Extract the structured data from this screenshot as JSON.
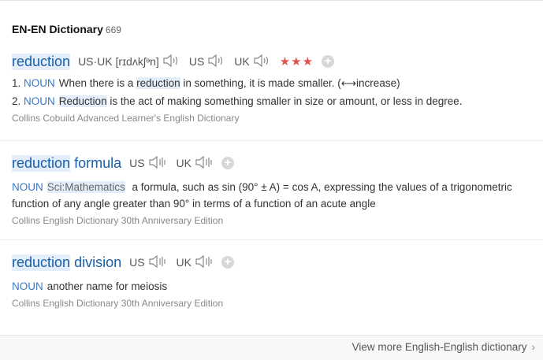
{
  "header": {
    "title": "EN-EN Dictionary",
    "count": "669"
  },
  "entries": [
    {
      "word_parts": [
        "reduction"
      ],
      "phonetics": [
        {
          "label": "US·UK [rɪdʌkʃᵊn]"
        },
        {
          "label": "US"
        },
        {
          "label": "UK"
        }
      ],
      "stars": "★★★",
      "senses": [
        {
          "num": "1.",
          "pos": "NOUN",
          "pre": "When there is a ",
          "hl": "reduction",
          "post": " in something, it is made smaller. (⟷increase)"
        },
        {
          "num": "2.",
          "pos": "NOUN",
          "pre": "",
          "hl": "Reduction",
          "post": " is the act of making something smaller in size or amount, or less in degree."
        }
      ],
      "source": "Collins Cobuild Advanced Learner's English Dictionary"
    },
    {
      "word_parts": [
        "reduction",
        "formula"
      ],
      "phonetics": [
        {
          "label": "US"
        },
        {
          "label": "UK"
        }
      ],
      "pos": "NOUN",
      "domain": "Sci:Mathematics",
      "definition": "a formula, such as sin (90° ± A) = cos A, expressing the values of a trigonometric function of any angle greater than 90° in terms of a function of an acute angle",
      "source": "Collins English Dictionary 30th Anniversary Edition"
    },
    {
      "word_parts": [
        "reduction",
        "division"
      ],
      "phonetics": [
        {
          "label": "US"
        },
        {
          "label": "UK"
        }
      ],
      "pos": "NOUN",
      "definition": "another name for meiosis",
      "source": "Collins English Dictionary 30th Anniversary Edition"
    }
  ],
  "footer": {
    "view_more": "View more English-English dictionary"
  },
  "icons": {
    "speaker": "speaker-icon",
    "plus": "add-icon",
    "chevron": "chevron-right-icon"
  },
  "colors": {
    "headword": "#1a5fa8",
    "pos": "#3a78c3",
    "stars": "#e1534a"
  }
}
